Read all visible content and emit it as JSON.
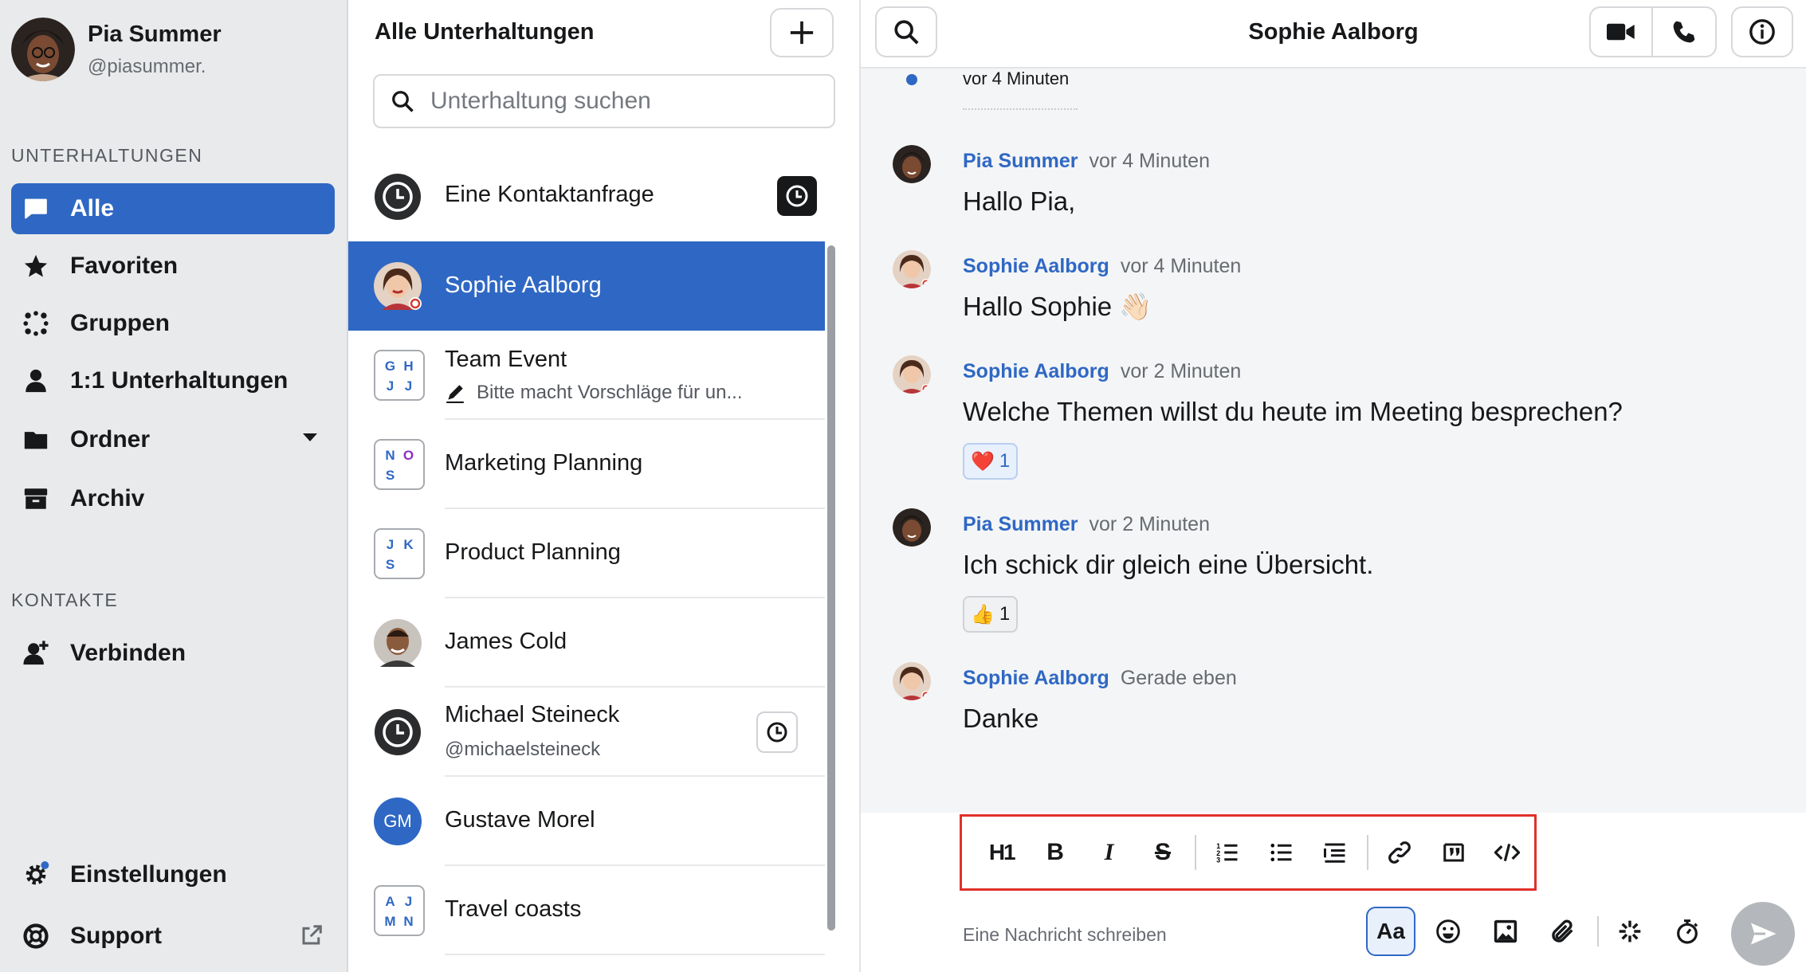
{
  "user": {
    "name": "Pia Summer",
    "handle": "@piasummer."
  },
  "sidebar": {
    "section_conversations": "UNTERHALTUNGEN",
    "items": [
      {
        "label": "Alle",
        "icon": "chat-bubble-icon",
        "active": true
      },
      {
        "label": "Favoriten",
        "icon": "star-icon"
      },
      {
        "label": "Gruppen",
        "icon": "group-dots-icon"
      },
      {
        "label": "1:1 Unterhaltungen",
        "icon": "person-icon"
      },
      {
        "label": "Ordner",
        "icon": "folder-icon"
      },
      {
        "label": "Archiv",
        "icon": "archive-icon"
      }
    ],
    "section_contacts": "KONTAKTE",
    "connect": "Verbinden",
    "settings": "Einstellungen",
    "support": "Support"
  },
  "list": {
    "title": "Alle Unterhaltungen",
    "search_placeholder": "Unterhaltung suchen",
    "items": [
      {
        "title": "Eine Kontaktanfrage",
        "type": "request"
      },
      {
        "title": "Sophie Aalborg",
        "type": "person",
        "selected": true
      },
      {
        "title": "Team Event",
        "subtitle": "Bitte macht Vorschläge für un...",
        "type": "group",
        "initials": [
          "G",
          "H",
          "J",
          "J"
        ]
      },
      {
        "title": "Marketing Planning",
        "type": "group",
        "initials": [
          "N",
          "O",
          "S"
        ]
      },
      {
        "title": "Product Planning",
        "type": "group",
        "initials": [
          "J",
          "K",
          "S"
        ]
      },
      {
        "title": "James Cold",
        "type": "person"
      },
      {
        "title": "Michael Steineck",
        "subtitle": "@michaelsteineck",
        "type": "pending"
      },
      {
        "title": "Gustave Morel",
        "type": "initials",
        "initials": "GM"
      },
      {
        "title": "Travel coasts",
        "type": "group",
        "initials": [
          "A",
          "J",
          "M",
          "N"
        ]
      }
    ]
  },
  "chat": {
    "title": "Sophie Aalborg",
    "top_timestamp": "vor 4 Minuten",
    "messages": [
      {
        "author": "Pia Summer",
        "time": "vor 4 Minuten",
        "text": "Hallo Pia,"
      },
      {
        "author": "Sophie Aalborg",
        "time": "vor 4 Minuten",
        "text": "Hallo Sophie 👋🏻"
      },
      {
        "author": "Sophie Aalborg",
        "time": "vor 2 Minuten",
        "text": "Welche Themen willst du heute im Meeting besprechen?",
        "reaction": {
          "emoji": "❤️",
          "count": "1"
        }
      },
      {
        "author": "Pia Summer",
        "time": "vor 2 Minuten",
        "text": "Ich schick dir gleich eine Übersicht.",
        "reaction": {
          "emoji": "👍",
          "count": "1"
        }
      },
      {
        "author": "Sophie Aalborg",
        "time": "Gerade eben",
        "text": "Danke"
      }
    ],
    "composer": {
      "placeholder": "Eine Nachricht schreiben",
      "format_buttons": [
        "H1",
        "B",
        "I",
        "S",
        "ordered-list",
        "bullet-list",
        "indent",
        "link",
        "quote",
        "code"
      ],
      "aa_label": "Aa"
    }
  },
  "colors": {
    "accent": "#2f68c4",
    "highlight_border": "#e0302a",
    "sidebar_bg": "#e9eaec"
  }
}
